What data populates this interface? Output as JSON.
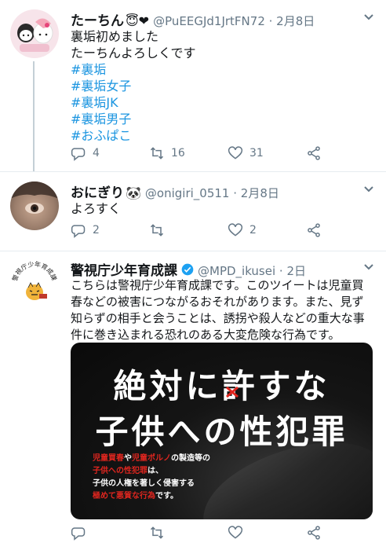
{
  "tweets": [
    {
      "name": "たーちん",
      "emoji": "😇❤",
      "handle": "@PuEEGJd1JrtFN72 · 2月8日",
      "lines": [
        "裏垢初めました",
        "たーちんよろしくです"
      ],
      "hashtags": [
        "#裏垢",
        "#裏垢女子",
        "#裏垢JK",
        "#裏垢男子",
        "#おふぱこ"
      ],
      "replies": "4",
      "retweets": "16",
      "likes": "31"
    },
    {
      "name": "おにぎり",
      "emoji": "🐼",
      "handle": "@onigiri_0511 · 2月8日",
      "lines": [
        "よろすく"
      ],
      "replies": "2",
      "retweets": "",
      "likes": "2"
    },
    {
      "name": "警視庁少年育成課",
      "handle": "@MPD_ikusei · 2日",
      "lines": [
        "こちらは警視庁少年育成課です。このツイートは児童買",
        "春などの被害につながるおそれがあります。また、見ず",
        "知らずの相手と会うことは、誘拐や殺人などの重大な事",
        "件に巻き込まれる恐れのある大変危険な行為です。"
      ],
      "avatar_text": "警視庁少年育成課",
      "banner": {
        "line1": "絶対に許すな",
        "line2": "子供への性犯罪",
        "small": [
          {
            "red": "児童買春",
            "white": "や"
          },
          {
            "red": "児童ポルノ",
            "white": "の製造等の"
          },
          {
            "red": "子供への性犯罪",
            "white": "は、"
          },
          {
            "red": "",
            "white": "子供の人権を著しく侵害する"
          },
          {
            "red": "極めて悪質な行為",
            "white": "です。"
          }
        ]
      },
      "replies": "",
      "retweets": "",
      "likes": ""
    }
  ],
  "colors": {
    "link": "#1b95e0",
    "muted": "#657786",
    "verified": "#1da1f2",
    "banner_red": "#e0261f"
  },
  "icons": [
    "reply-icon",
    "retweet-icon",
    "like-icon",
    "share-icon",
    "caret-down-icon",
    "verified-badge-icon"
  ]
}
